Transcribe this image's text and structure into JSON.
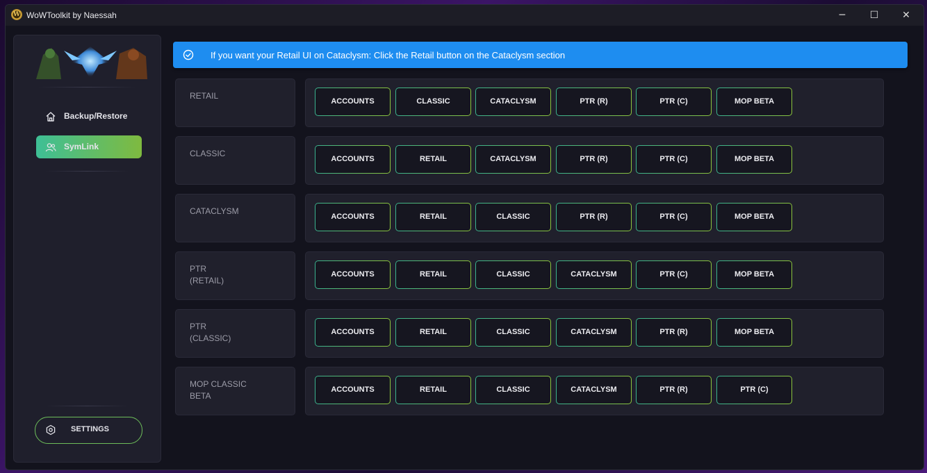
{
  "window": {
    "title": "WoWToolkit by Naessah",
    "app_icon_letter": "W",
    "controls": {
      "minimize": "─",
      "maximize": "☐",
      "close": "✕"
    }
  },
  "sidebar": {
    "nav": [
      {
        "label": "Backup/Restore",
        "icon": "home-icon",
        "active": false
      },
      {
        "label": "SymLink",
        "icon": "users-icon",
        "active": true
      }
    ],
    "settings_label": "SETTINGS",
    "settings_icon": "gear-icon"
  },
  "banner": {
    "icon": "check-circle-icon",
    "text": "If you want your Retail UI on Cataclysm: Click the Retail button on the Cataclysm section",
    "color": "#1e8df0"
  },
  "rows": [
    {
      "label": "RETAIL",
      "buttons": [
        "ACCOUNTS",
        "CLASSIC",
        "CATACLYSM",
        "PTR (R)",
        "PTR (C)",
        "MOP BETA"
      ]
    },
    {
      "label": "CLASSIC",
      "buttons": [
        "ACCOUNTS",
        "RETAIL",
        "CATACLYSM",
        "PTR (R)",
        "PTR (C)",
        "MOP BETA"
      ]
    },
    {
      "label": "CATACLYSM",
      "buttons": [
        "ACCOUNTS",
        "RETAIL",
        "CLASSIC",
        "PTR (R)",
        "PTR (C)",
        "MOP BETA"
      ]
    },
    {
      "label": "PTR\n(RETAIL)",
      "buttons": [
        "ACCOUNTS",
        "RETAIL",
        "CLASSIC",
        "CATACLYSM",
        "PTR (C)",
        "MOP BETA"
      ]
    },
    {
      "label": "PTR\n(CLASSIC)",
      "buttons": [
        "ACCOUNTS",
        "RETAIL",
        "CLASSIC",
        "CATACLYSM",
        "PTR (R)",
        "MOP BETA"
      ]
    },
    {
      "label": "MOP CLASSIC\nBETA",
      "buttons": [
        "ACCOUNTS",
        "RETAIL",
        "CLASSIC",
        "CATACLYSM",
        "PTR (R)",
        "PTR (C)"
      ]
    }
  ],
  "colors": {
    "accent_start": "#3ab38f",
    "accent_end": "#8cc53d",
    "panel": "#20202c",
    "background": "#13131d"
  }
}
